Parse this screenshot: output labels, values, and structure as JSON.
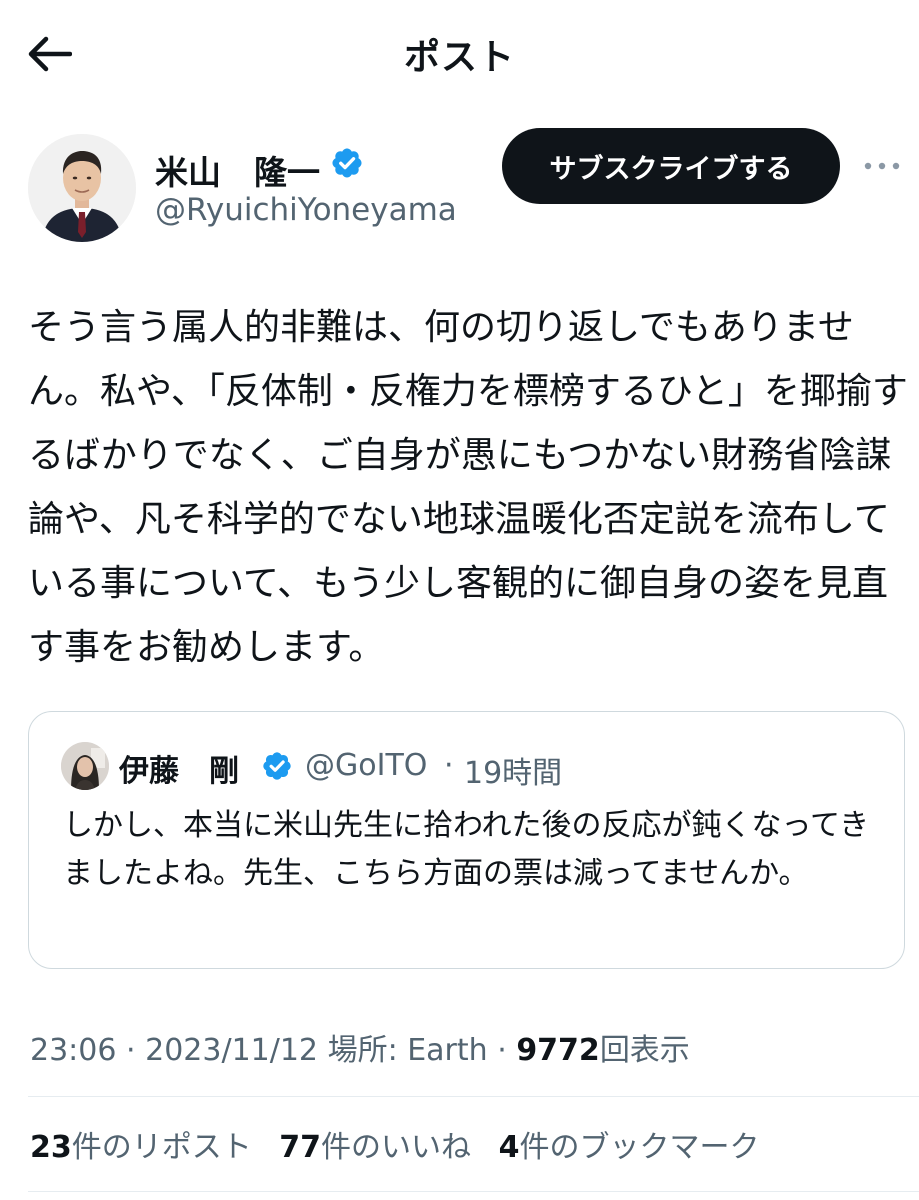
{
  "header": {
    "title": "ポスト",
    "back_icon": "arrow-left-icon"
  },
  "author": {
    "name": "米山　隆一",
    "handle": "@RyuichiYoneyama",
    "verified_icon": "verified-badge-icon",
    "verified_color": "#1d9bf0"
  },
  "subscribe_label": "サブスクライブする",
  "more_icon": "more-horizontal-icon",
  "post": {
    "text": "そう言う属人的非難は、何の切り返しでもありません。私や、「反体制・反権力を標榜するひと」を揶揄するばかりでなく、ご自身が愚にもつかない財務省陰謀論や、凡そ科学的でない地球温暖化否定説を流布している事について、もう少し客観的に御自身の姿を見直す事をお勧めします。"
  },
  "quote": {
    "name": "伊藤　剛",
    "handle": "@GoITO",
    "separator": "·",
    "time": "19時間",
    "text": "しかし、本当に米山先生に拾われた後の反応が鈍くなってきましたよね。先生、こちら方面の票は減ってませんか。"
  },
  "meta": {
    "time": "23:06",
    "date": "2023/11/12",
    "location": "場所: Earth",
    "views_count": "9772",
    "views_label": "回表示",
    "separator": "·"
  },
  "stats": {
    "reposts_count": "23",
    "reposts_label": "件のリポスト",
    "likes_count": "77",
    "likes_label": "件のいいね",
    "bookmarks_count": "4",
    "bookmarks_label": "件のブックマーク"
  },
  "colors": {
    "text": "#0f1419",
    "secondary": "#536471",
    "button_bg": "#0f1419",
    "border": "#cfd9de",
    "verified": "#1d9bf0"
  }
}
